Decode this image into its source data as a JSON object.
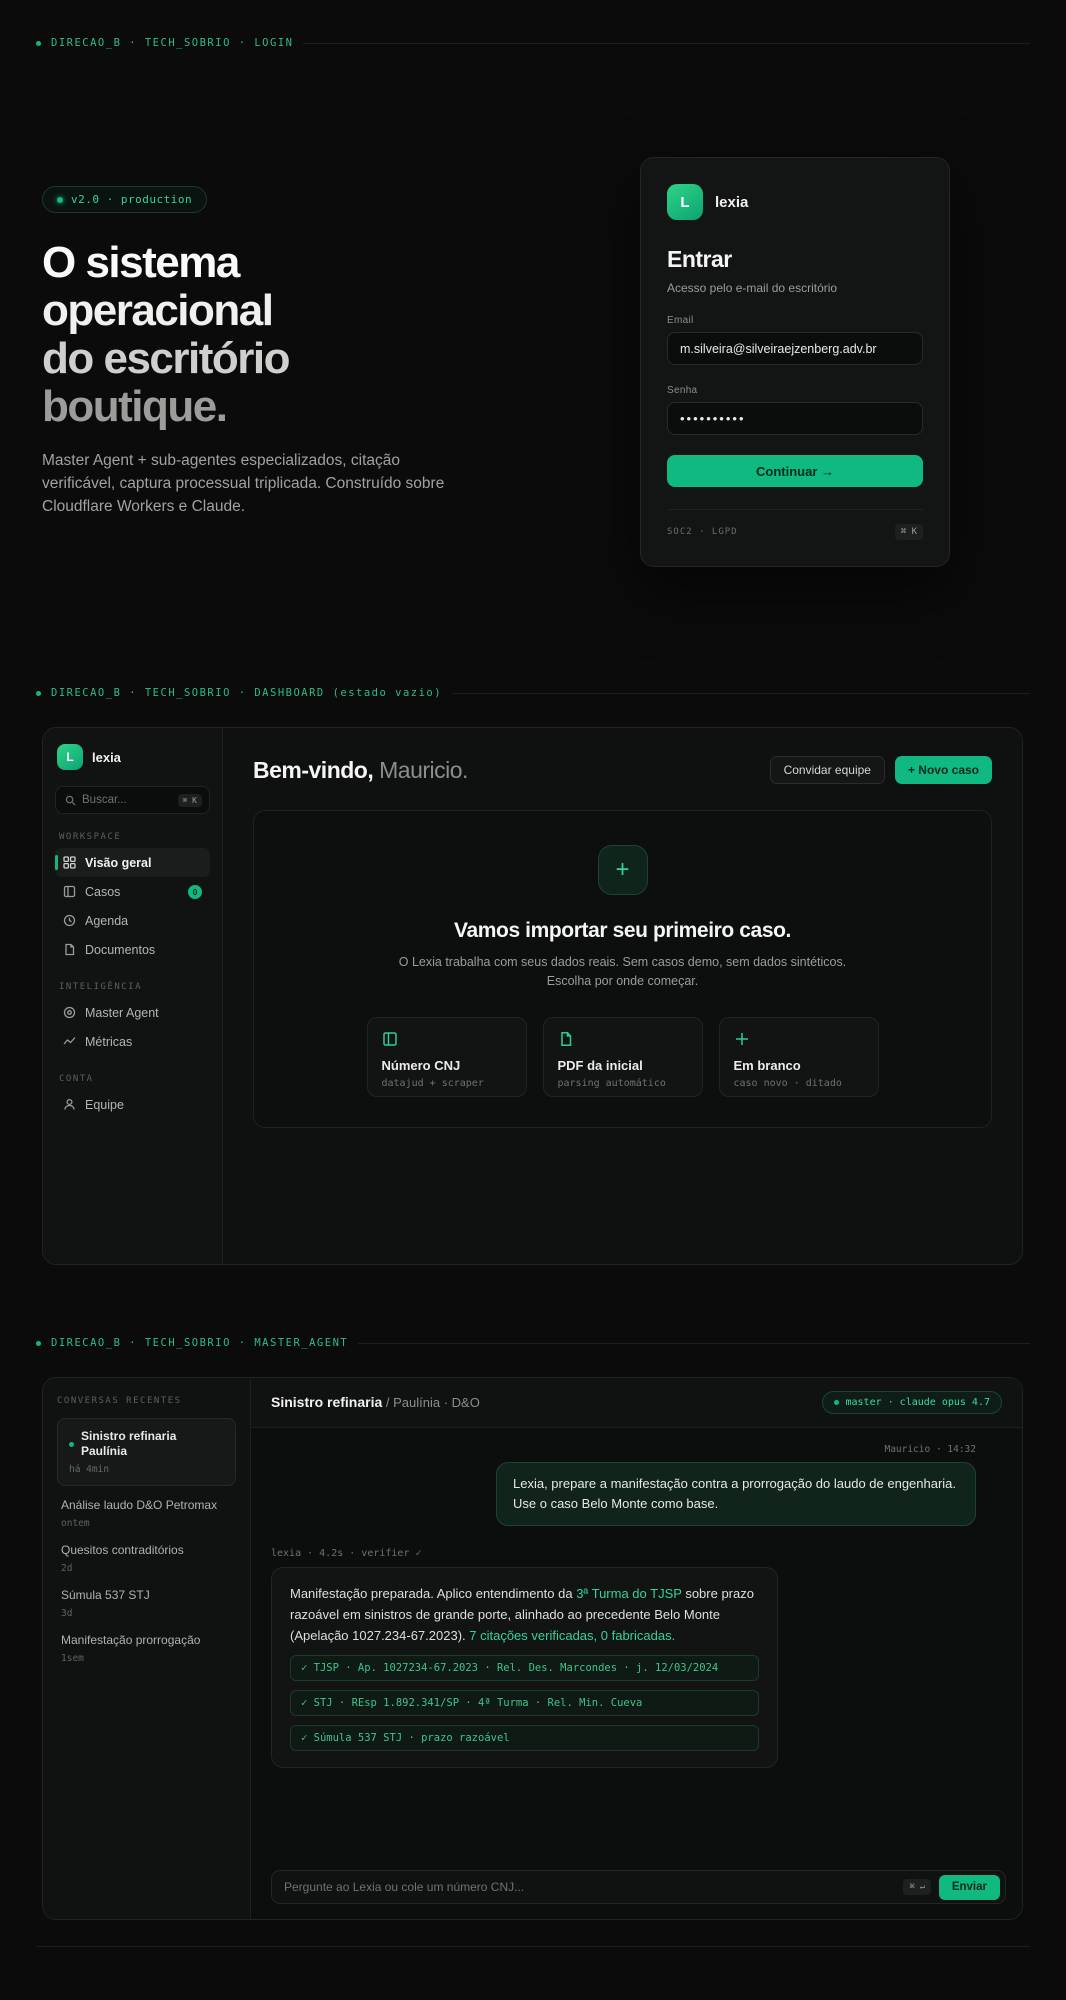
{
  "colors": {
    "accent": "#10b981",
    "accent_text": "#34d399",
    "background": "#0a0b0a"
  },
  "section_headers": {
    "login": "DIRECAO_B · TECH_SOBRIO · LOGIN",
    "dashboard": "DIRECAO_B · TECH_SOBRIO · DASHBOARD (estado vazio)",
    "master_agent": "DIRECAO_B · TECH_SOBRIO · MASTER_AGENT"
  },
  "hero": {
    "badge": "v2.0 · production",
    "title_lines": [
      "O sistema",
      "operacional",
      "do escritório",
      "boutique."
    ],
    "subtitle": "Master Agent + sub-agentes especializados, citação verificável, captura processual triplicada. Construído sobre Cloudflare Workers e Claude."
  },
  "login_card": {
    "logo_letter": "L",
    "brand": "lexia",
    "title": "Entrar",
    "subtitle": "Acesso pelo e-mail do escritório",
    "email_label": "Email",
    "email_value": "m.silveira@silveiraejzenberg.adv.br",
    "password_label": "Senha",
    "password_value": "••••••••••",
    "submit_label": "Continuar →",
    "compliance": "SOC2 · LGPD",
    "kbd": "⌘ K"
  },
  "dashboard": {
    "sidebar": {
      "logo_letter": "L",
      "brand": "lexia",
      "search_placeholder": "Buscar...",
      "search_kbd": "⌘ K",
      "sections": [
        {
          "label": "WORKSPACE",
          "items": [
            {
              "label": "Visão geral"
            },
            {
              "label": "Casos",
              "badge": "0"
            },
            {
              "label": "Agenda"
            },
            {
              "label": "Documentos"
            }
          ]
        },
        {
          "label": "INTELIGÊNCIA",
          "items": [
            {
              "label": "Master Agent"
            },
            {
              "label": "Métricas"
            }
          ]
        },
        {
          "label": "CONTA",
          "items": [
            {
              "label": "Equipe"
            }
          ]
        }
      ]
    },
    "welcome_bold": "Bem-vindo,",
    "welcome_name": " Mauricio.",
    "invite_button": "Convidar equipe",
    "new_case_button": "+ Novo caso",
    "empty_state": {
      "plus": "+",
      "title": "Vamos importar seu primeiro caso.",
      "subtitle": "O Lexia trabalha com seus dados reais. Sem casos demo, sem dados sintéticos. Escolha por onde começar.",
      "options": [
        {
          "title": "Número CNJ",
          "subtitle": "datajud + scraper"
        },
        {
          "title": "PDF da inicial",
          "subtitle": "parsing automático"
        },
        {
          "title": "Em branco",
          "subtitle": "caso novo · ditado"
        }
      ]
    }
  },
  "master_agent": {
    "sidebar_label": "CONVERSAS RECENTES",
    "conversations": [
      {
        "title": "Sinistro refinaria Paulínia",
        "time": "há 4min"
      },
      {
        "title": "Análise laudo D&O Petromax",
        "time": "ontem"
      },
      {
        "title": "Quesitos contraditórios",
        "time": "2d"
      },
      {
        "title": "Súmula 537 STJ",
        "time": "3d"
      },
      {
        "title": "Manifestação prorrogação",
        "time": "1sem"
      }
    ],
    "chat_title": "Sinistro refinaria",
    "chat_subtitle": " / Paulínia · D&O",
    "model_badge": "master · claude opus 4.7",
    "user_meta": "Mauricio · 14:32",
    "user_message": "Lexia, prepare a manifestação contra a prorrogação do laudo de engenharia. Use o caso Belo Monte como base.",
    "agent_meta": "lexia · 4.2s · verifier ✓",
    "agent_message": {
      "part1": "Manifestação preparada. Aplico entendimento da ",
      "highlight1": "3ª Turma do TJSP",
      "part2": " sobre prazo razoável em sinistros de grande porte, alinhado ao precedente Belo Monte (Apelação 1027.234-67.2023). ",
      "highlight2": "7 citações verificadas, 0 fabricadas."
    },
    "citations": [
      "✓ TJSP · Ap. 1027234-67.2023 · Rel. Des. Marcondes · j. 12/03/2024",
      "✓ STJ · REsp 1.892.341/SP · 4ª Turma · Rel. Min. Cueva",
      "✓ Súmula 537 STJ · prazo razoável"
    ],
    "input_placeholder": "Pergunte ao Lexia ou cole um número CNJ...",
    "input_kbd": "⌘ ↵",
    "send_button": "Enviar"
  }
}
